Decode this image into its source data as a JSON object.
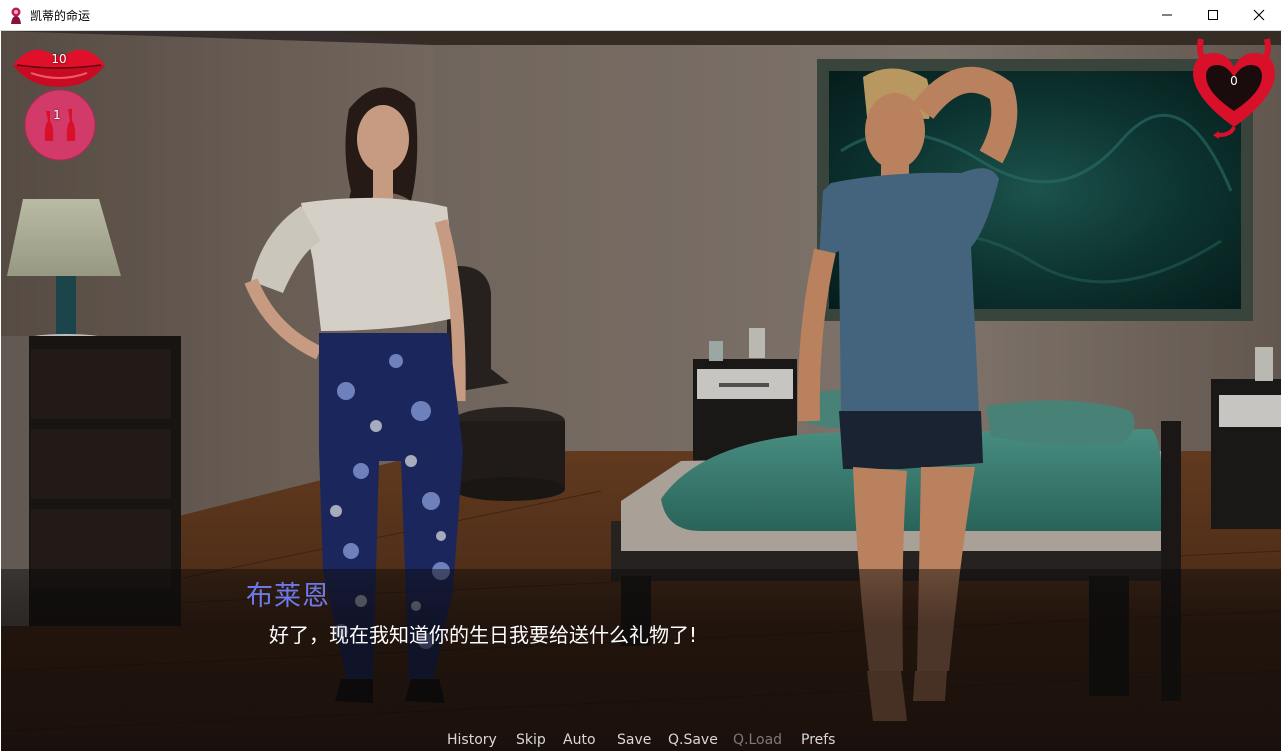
{
  "window": {
    "title": "凯蒂的命运",
    "controls": [
      "minimize-icon",
      "maximize-icon",
      "close-icon"
    ]
  },
  "hud": {
    "lips_value": "10",
    "drinks_value": "1",
    "heart_value": "0",
    "icons": [
      "lips-icon",
      "drinks-icon",
      "devil-heart-icon"
    ]
  },
  "dialogue": {
    "speaker": "布莱恩",
    "text": "好了，现在我知道你的生日我要给送什么礼物了!"
  },
  "quick_menu": {
    "items": [
      {
        "label": "History",
        "enabled": true
      },
      {
        "label": "Skip",
        "enabled": true
      },
      {
        "label": "Auto",
        "enabled": true
      },
      {
        "label": "Save",
        "enabled": true
      },
      {
        "label": "Q.Save",
        "enabled": true
      },
      {
        "label": "Q.Load",
        "enabled": false
      },
      {
        "label": "Prefs",
        "enabled": true
      }
    ]
  },
  "colors": {
    "speaker": "#6d79e8",
    "dialogue": "#ffffff",
    "menu": "#d8d8d8",
    "menu_disabled": "#7a7a7a",
    "hud_red": "#d8102a"
  }
}
